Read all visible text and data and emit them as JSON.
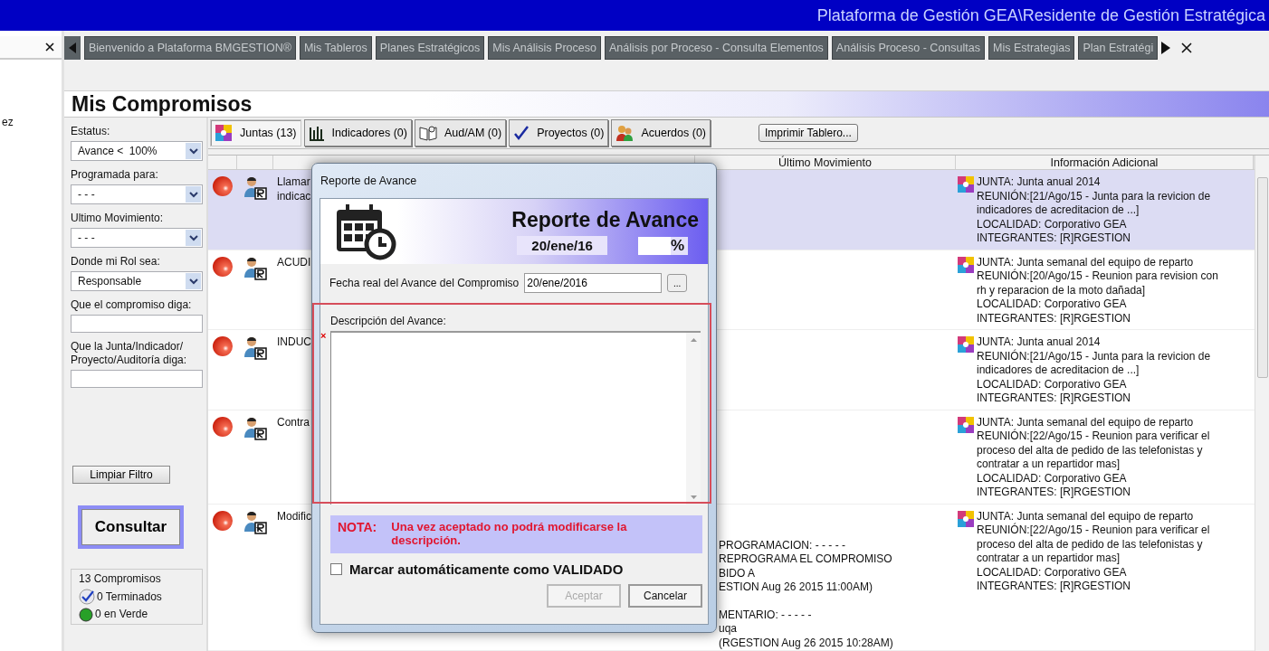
{
  "window": {
    "title": "Plataforma de Gestión GEA\\Residente de Gestión Estratégica"
  },
  "side_strip": {
    "text": "ez"
  },
  "doc_tabs": [
    {
      "label": "Bienvenido a Plataforma BMGESTION®",
      "selected": false
    },
    {
      "label": "Mis Tableros",
      "selected": false
    },
    {
      "label": "Planes Estratégicos",
      "selected": false
    },
    {
      "label": "Mis Análisis Proceso",
      "selected": false
    },
    {
      "label": "Análisis por Proceso - Consulta Elementos",
      "selected": false
    },
    {
      "label": "Análisis Proceso - Consultas",
      "selected": false
    },
    {
      "label": "Mis Estrategias",
      "selected": false
    },
    {
      "label": "Plan Estratégi",
      "selected": false
    }
  ],
  "page": {
    "title": "Mis Compromisos"
  },
  "filters": [
    {
      "kind": "select",
      "label": "Estatus:",
      "value": "Avance <  100%"
    },
    {
      "kind": "select",
      "label": "Programada para:",
      "value": "- - -"
    },
    {
      "kind": "select",
      "label": "Ultimo Movimiento:",
      "value": "- - -"
    },
    {
      "kind": "select",
      "label": "Donde mi Rol sea:",
      "value": "Responsable"
    },
    {
      "kind": "text",
      "label": "Que el compromiso diga:"
    },
    {
      "kind": "text",
      "label": "Que la Junta/Indicador/ Proyecto/Auditoría diga:"
    }
  ],
  "clear_button": "Limpiar Filtro",
  "query_button": "Consultar",
  "summary": {
    "title": "13 Compromisos",
    "items": [
      {
        "kind": "done",
        "label": "0 Terminados"
      },
      {
        "kind": "green",
        "label": "0 en Verde"
      }
    ]
  },
  "toolbar_tabs": [
    {
      "kind": "juntas",
      "label": "Juntas (13)",
      "selected": true
    },
    {
      "kind": "indicadores",
      "label": "Indicadores (0)",
      "selected": false
    },
    {
      "kind": "aud",
      "label": "Aud/AM (0)",
      "selected": false
    },
    {
      "kind": "proyectos",
      "label": "Proyectos (0)",
      "selected": false
    },
    {
      "kind": "acuerdos",
      "label": "Acuerdos (0)",
      "selected": false
    }
  ],
  "print_button": "Imprimir Tablero...",
  "table": {
    "columns": [
      "Último Movimiento",
      "Información Adicional"
    ],
    "rows": [
      {
        "selected": true,
        "description": "Llamar indicac",
        "info": [
          "JUNTA: Junta anual 2014",
          "REUNIÓN:[21/Ago/15 - Junta para la revicion de",
          "indicadores de acreditacion de ...]",
          "LOCALIDAD: Corporativo GEA",
          "INTEGRANTES: [R]RGESTION"
        ]
      },
      {
        "selected": false,
        "description": "ACUDI",
        "info": [
          "JUNTA: Junta semanal del equipo de reparto",
          "REUNIÓN:[20/Ago/15 - Reunion para revision con",
          "rh y reparacion de la moto dañada]",
          "LOCALIDAD: Corporativo GEA",
          "INTEGRANTES: [R]RGESTION"
        ]
      },
      {
        "selected": false,
        "description": "INDUC",
        "info": [
          "JUNTA: Junta anual 2014",
          "REUNIÓN:[21/Ago/15 - Junta para la revicion de",
          "indicadores de acreditacion de ...]",
          "LOCALIDAD: Corporativo GEA",
          "INTEGRANTES: [R]RGESTION"
        ]
      },
      {
        "selected": false,
        "description": "Contra",
        "info": [
          "JUNTA: Junta semanal del equipo de reparto",
          "REUNIÓN:[22/Ago/15 - Reunion para verificar el",
          "proceso del alta de pedido de las telefonistas y",
          "contratar a un repartidor mas]",
          "LOCALIDAD: Corporativo GEA",
          "INTEGRANTES: [R]RGESTION"
        ]
      },
      {
        "selected": false,
        "description": "Modific",
        "movement": [
          [
            "PROGRAMACION: - - - - -",
            "REPROGRAMA EL COMPROMISO",
            "BIDO A",
            "ESTION Aug 26 2015 11:00AM)"
          ],
          [
            "MENTARIO: - - - - -",
            "uqa",
            "(RGESTION Aug 26 2015 10:28AM)"
          ]
        ],
        "info": [
          "JUNTA: Junta semanal del equipo de reparto",
          "REUNIÓN:[22/Ago/15 - Reunion para verificar el",
          "proceso del alta de pedido de las telefonistas y",
          "contratar a un repartidor mas]",
          "LOCALIDAD: Corporativo GEA",
          "INTEGRANTES: [R]RGESTION"
        ]
      }
    ]
  },
  "dialog": {
    "title": "Reporte de Avance",
    "heading": "Reporte de Avance",
    "date": "20/ene/16",
    "percent_unit": "%",
    "date_label": "Fecha real del Avance del Compromiso",
    "date_value": "20/ene/2016",
    "date_button": "...",
    "description_label": "Descripción del Avance:",
    "required_mark": "×",
    "note_label": "NOTA:",
    "note_text": "Una vez aceptado no podrá modificarse la descripción.",
    "validate": {
      "label": "Marcar automáticamente como VALIDADO",
      "checked": false
    },
    "buttons": [
      {
        "label": "Aceptar",
        "disabled": true
      },
      {
        "label": "Cancelar",
        "disabled": false
      }
    ]
  }
}
